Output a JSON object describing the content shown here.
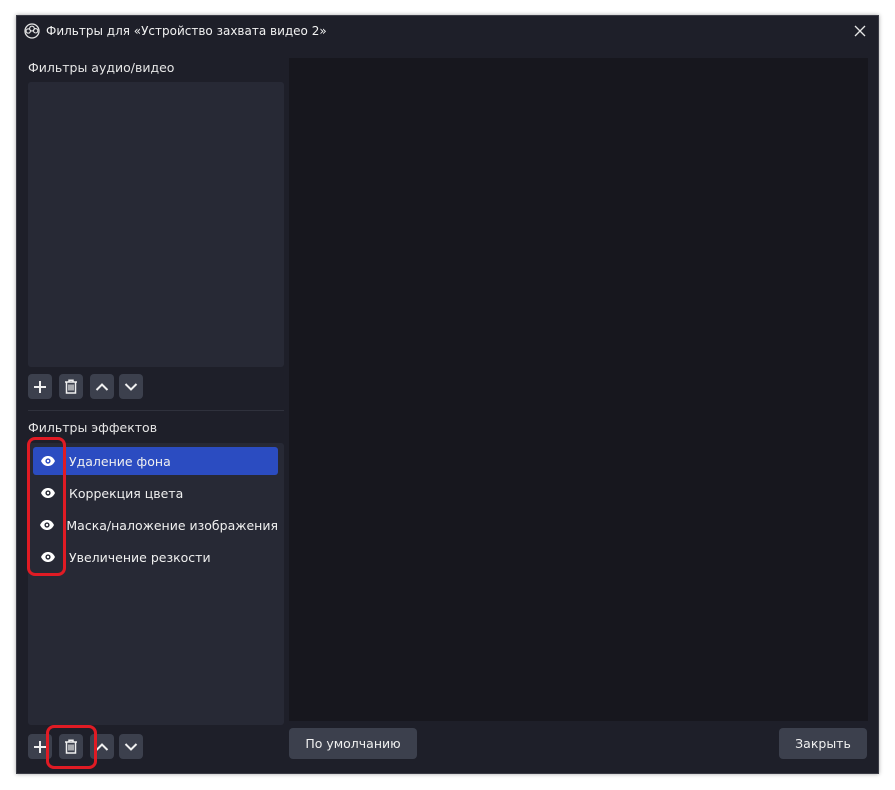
{
  "window": {
    "title": "Фильтры для «Устройство захвата видео 2»",
    "app_icon": "obs-icon",
    "close_icon": "close-icon"
  },
  "audio_video_filters": {
    "label": "Фильтры аудио/видео",
    "items": []
  },
  "effect_filters": {
    "label": "Фильтры эффектов",
    "items": [
      {
        "label": "Удаление фона",
        "visible_icon": "eye-icon",
        "selected": true
      },
      {
        "label": "Коррекция цвета",
        "visible_icon": "eye-icon",
        "selected": false
      },
      {
        "label": "Маска/наложение изображения",
        "visible_icon": "eye-icon",
        "selected": false
      },
      {
        "label": "Увеличение резкости",
        "visible_icon": "eye-icon",
        "selected": false
      }
    ]
  },
  "toolbar_icons": [
    "plus-icon",
    "trash-icon",
    "chevron-up-icon",
    "chevron-down-icon"
  ],
  "buttons": {
    "defaults": "По умолчанию",
    "close": "Закрыть"
  },
  "colors": {
    "window_bg": "#1e1f29",
    "panel_bg": "#272935",
    "preview_bg": "#17171e",
    "button_bg": "#3c404d",
    "selection": "#2b4cc1",
    "annotation": "#e01b24"
  }
}
